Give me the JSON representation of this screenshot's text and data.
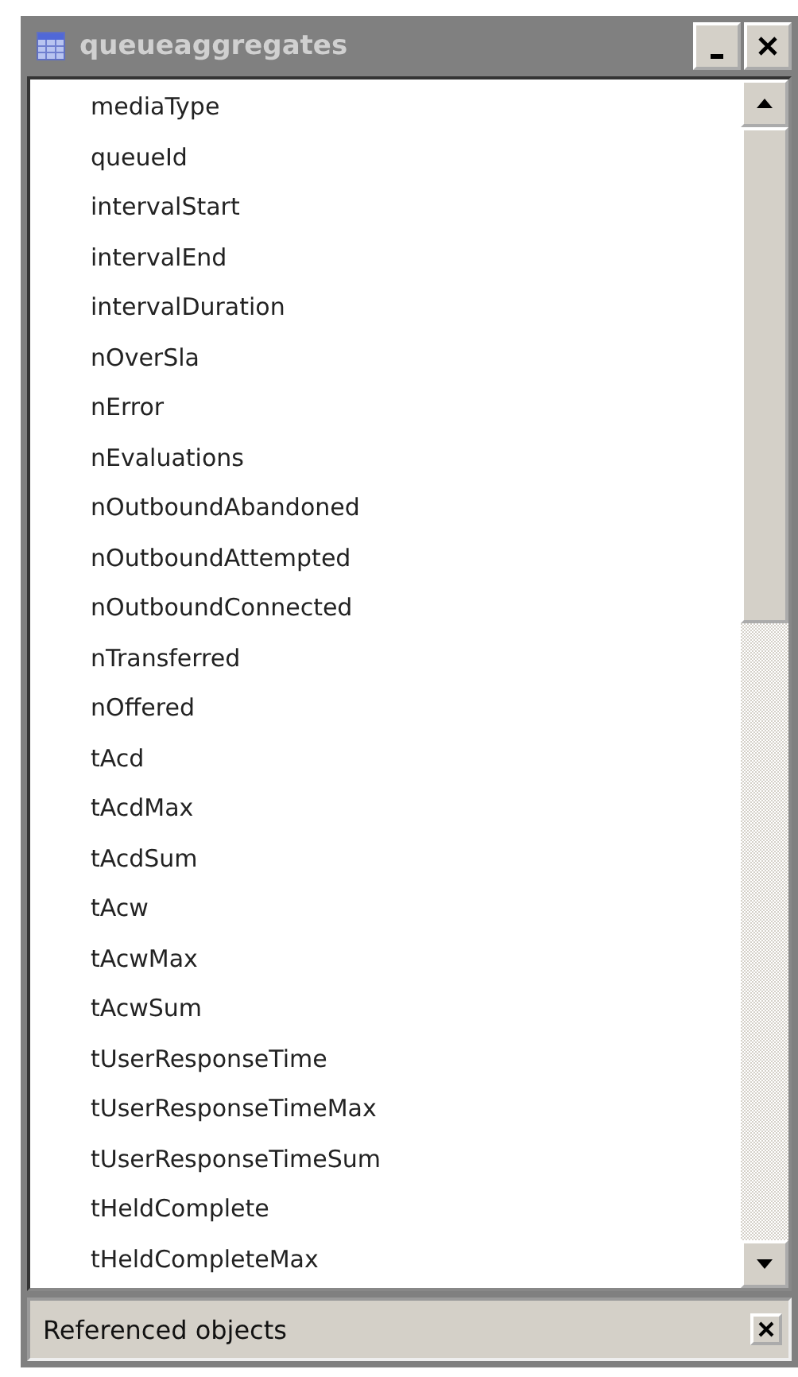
{
  "window": {
    "title": "queueaggregates"
  },
  "fields": [
    "mediaType",
    "queueId",
    "intervalStart",
    "intervalEnd",
    "intervalDuration",
    "nOverSla",
    "nError",
    "nEvaluations",
    "nOutboundAbandoned",
    "nOutboundAttempted",
    "nOutboundConnected",
    "nTransferred",
    "nOffered",
    "tAcd",
    "tAcdMax",
    "tAcdSum",
    "tAcw",
    "tAcwMax",
    "tAcwSum",
    "tUserResponseTime",
    "tUserResponseTimeMax",
    "tUserResponseTimeSum",
    "tHeldComplete",
    "tHeldCompleteMax"
  ],
  "status_bar": {
    "label": "Referenced objects"
  }
}
